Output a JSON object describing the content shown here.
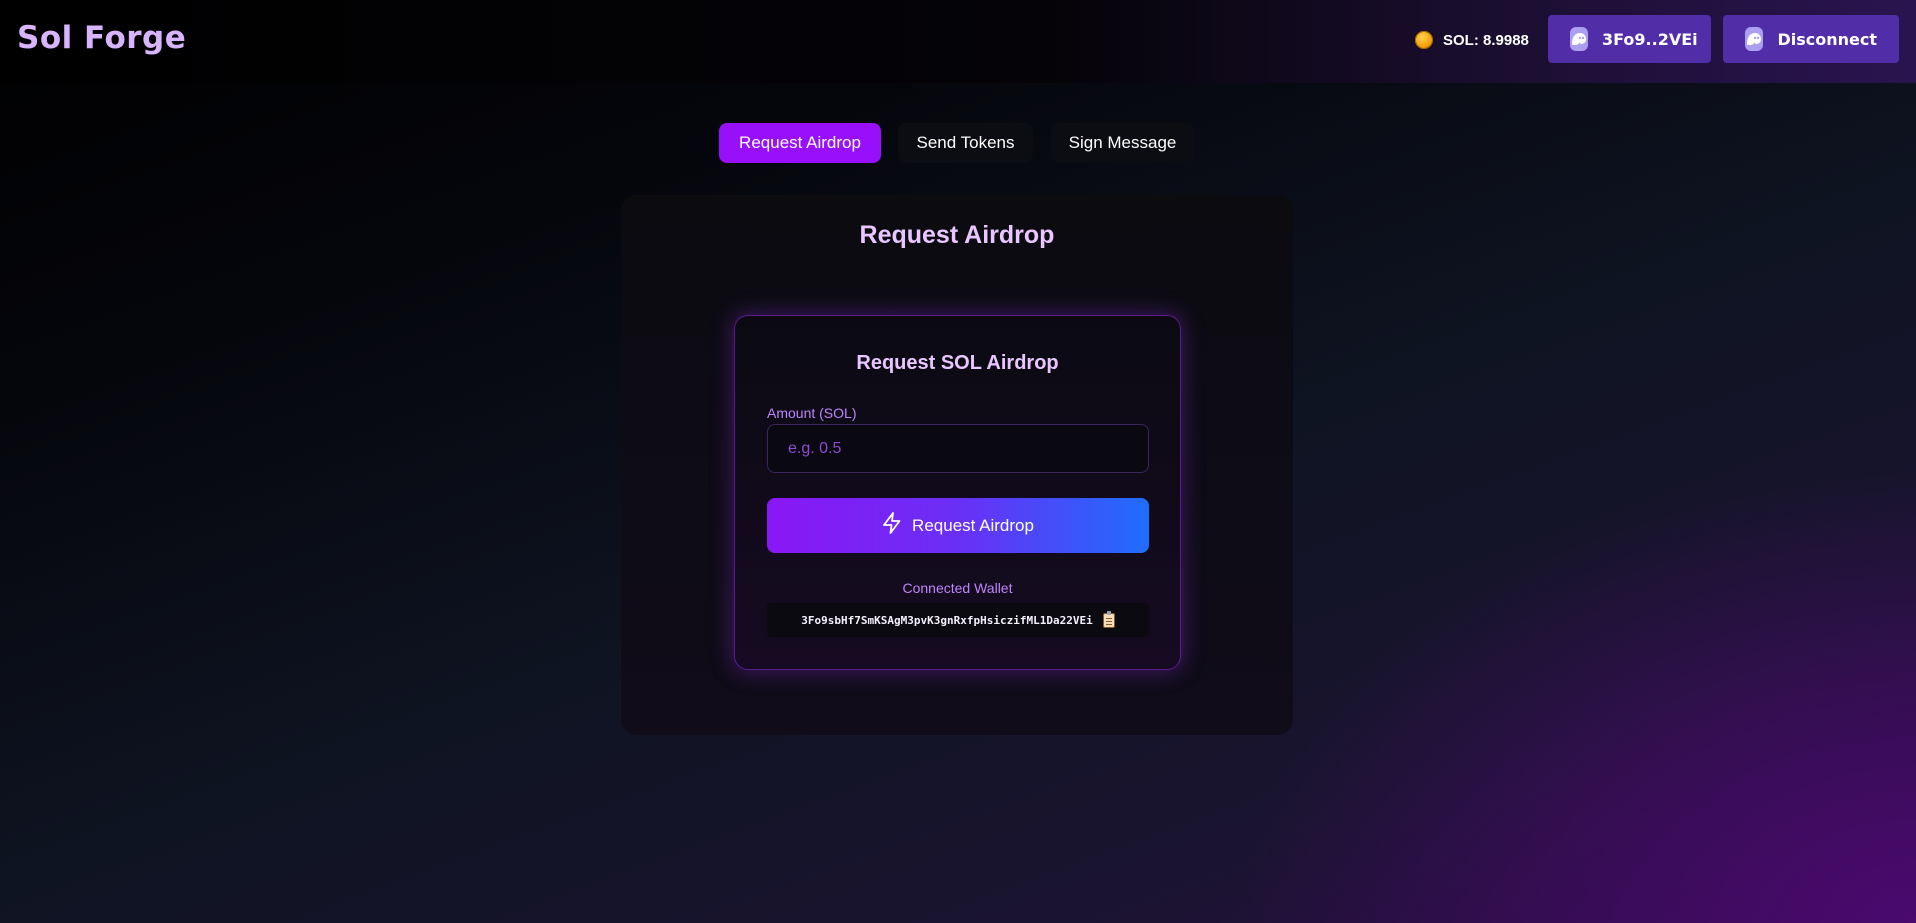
{
  "header": {
    "logo": "Sol Forge",
    "balance_text": "SOL: 8.9988",
    "wallet_button": "3Fo9..2VEi",
    "disconnect_button": "Disconnect"
  },
  "tabs": [
    {
      "label": "Request Airdrop",
      "active": true
    },
    {
      "label": "Send Tokens",
      "active": false
    },
    {
      "label": "Sign Message",
      "active": false
    }
  ],
  "main": {
    "title": "Request Airdrop",
    "panel": {
      "title": "Request SOL Airdrop",
      "amount_label": "Amount (SOL)",
      "amount_placeholder": "e.g. 0.5",
      "amount_value": "",
      "submit_label": "Request Airdrop",
      "wallet_label": "Connected Wallet",
      "wallet_address": "3Fo9sbHf7SmKSAgM3pvK3gnRxfpHsiczifML1Da22VEi"
    }
  },
  "colors": {
    "accent": "#9810fa",
    "wallet_button": "#512da8",
    "title_text": "#e9c6ff",
    "label_text": "#c084fc"
  },
  "icons": {
    "balance": "sol-coin-icon",
    "wallet": "phantom-icon",
    "submit": "lightning-icon",
    "copy": "clipboard-icon"
  }
}
